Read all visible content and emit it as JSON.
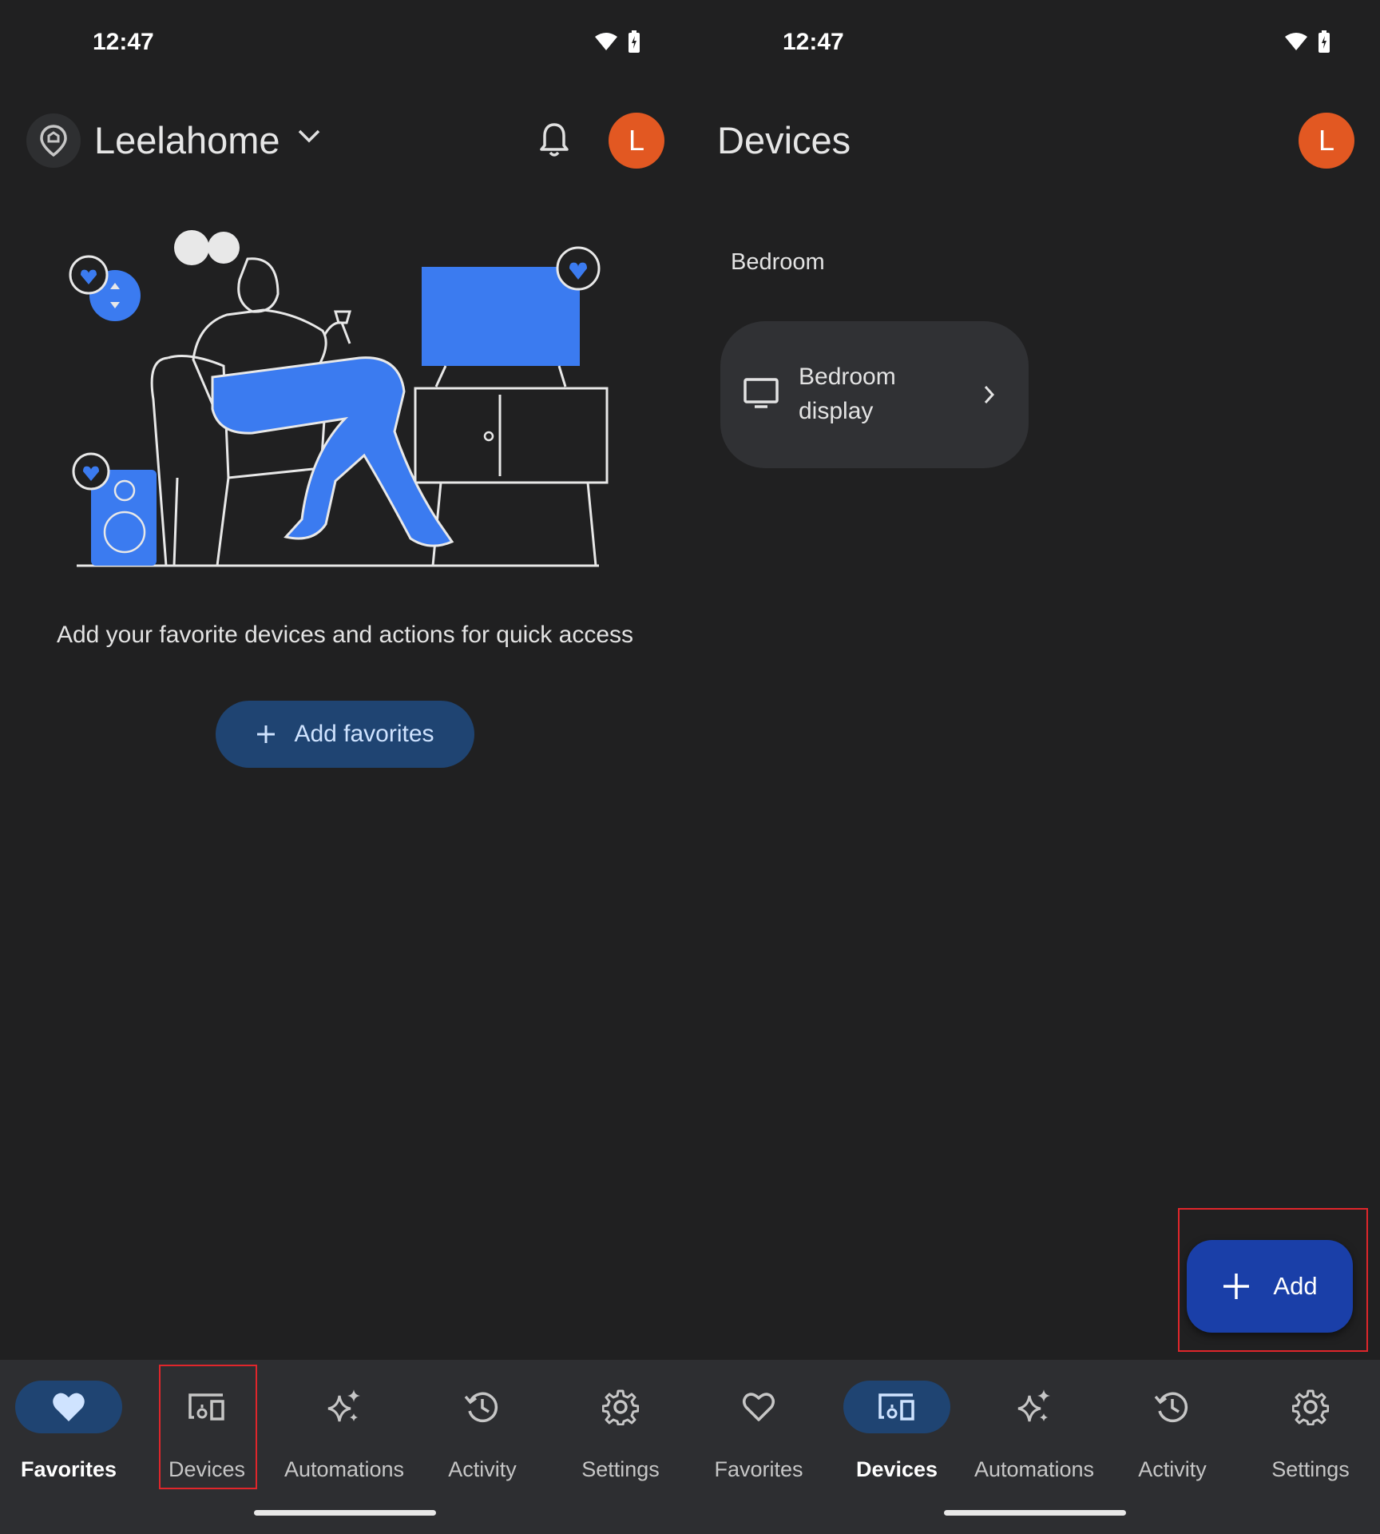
{
  "left": {
    "status_time": "12:47",
    "home_name": "Leelahome",
    "avatar_letter": "L",
    "favorites_prompt": "Add your favorite devices and actions for quick access",
    "add_favorites_label": "Add favorites",
    "nav": [
      "Favorites",
      "Devices",
      "Automations",
      "Activity",
      "Settings"
    ],
    "active_tab": "Favorites"
  },
  "right": {
    "status_time": "12:47",
    "title": "Devices",
    "avatar_letter": "L",
    "room": "Bedroom",
    "device_name": "Bedroom display",
    "add_label": "Add",
    "nav": [
      "Favorites",
      "Devices",
      "Automations",
      "Activity",
      "Settings"
    ],
    "active_tab": "Devices"
  },
  "colors": {
    "background": "#202021",
    "avatar": "#e25822",
    "accent_pill": "#1f4472",
    "fab": "#1a3fa8",
    "highlight": "#e0262b",
    "illustration_blue": "#3b7bf0"
  },
  "icons": {
    "status": [
      "wifi-icon",
      "battery-charging-icon"
    ],
    "header_left": [
      "home-pin-icon",
      "chevron-down-icon",
      "bell-icon"
    ],
    "device": [
      "display-icon",
      "chevron-right-icon"
    ],
    "nav": [
      "heart-icon",
      "devices-icon",
      "sparkle-icon",
      "history-icon",
      "gear-icon"
    ]
  }
}
